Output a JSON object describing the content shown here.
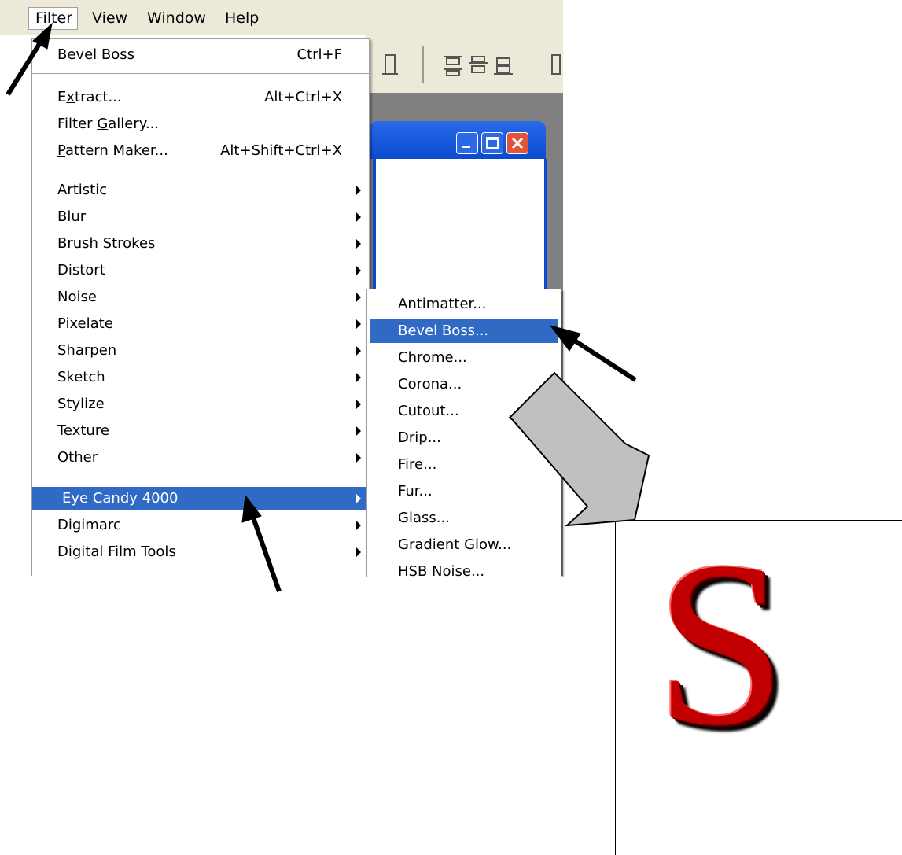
{
  "menubar": {
    "items": [
      {
        "label_pre": "Fi",
        "underline": "l",
        "label_post": "ter"
      },
      {
        "label_pre": "",
        "underline": "V",
        "label_post": "iew"
      },
      {
        "label_pre": "",
        "underline": "W",
        "label_post": "indow"
      },
      {
        "label_pre": "",
        "underline": "H",
        "label_post": "elp"
      }
    ]
  },
  "filter_menu": {
    "last_filter": {
      "label": "Bevel Boss",
      "shortcut": "Ctrl+F"
    },
    "extract": {
      "pre": "E",
      "u": "x",
      "post": "tract...",
      "shortcut": "Alt+Ctrl+X"
    },
    "gallery": {
      "pre": "Filter ",
      "u": "G",
      "post": "allery..."
    },
    "pattern": {
      "pre": "",
      "u": "P",
      "post": "attern Maker...",
      "shortcut": "Alt+Shift+Ctrl+X"
    },
    "categories": [
      "Artistic",
      "Blur",
      "Brush Strokes",
      "Distort",
      "Noise",
      "Pixelate",
      "Sharpen",
      "Sketch",
      "Stylize",
      "Texture",
      "Other"
    ],
    "plugins": [
      "Eye Candy 4000",
      "Digimarc",
      "Digital Film Tools"
    ],
    "highlighted": "Eye Candy 4000"
  },
  "submenu": {
    "items": [
      "Antimatter...",
      "Bevel Boss...",
      "Chrome...",
      "Corona...",
      "Cutout...",
      "Drip...",
      "Fire...",
      "Fur...",
      "Glass...",
      "Gradient Glow...",
      "HSB Noise..."
    ],
    "highlighted": "Bevel Boss..."
  },
  "preview": {
    "letter": "S",
    "color": "#c00000"
  },
  "colors": {
    "highlight": "#316ac5",
    "titlebar": "#0a4ad0",
    "close": "#e2543a",
    "arrow": "#c0c0c0"
  }
}
